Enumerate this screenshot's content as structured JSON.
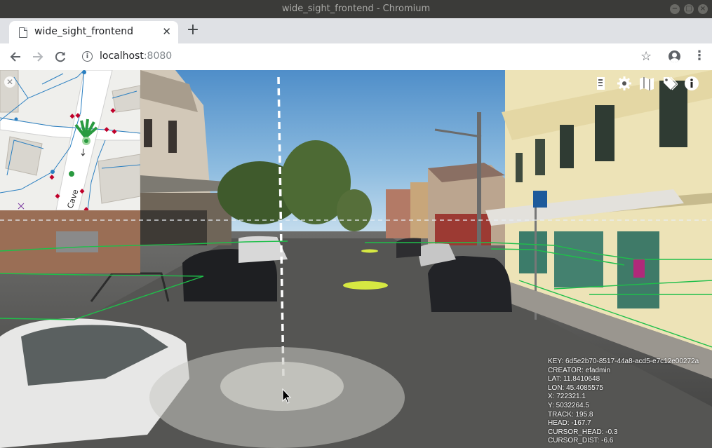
{
  "window": {
    "title": "wide_sight_frontend - Chromium"
  },
  "tab": {
    "title": "wide_sight_frontend",
    "icon": "page-icon"
  },
  "toolbar": {
    "host": "localhost",
    "port": ":8080"
  },
  "map": {
    "street_label": "Cave"
  },
  "tools": [
    "book-icon",
    "gear-icon",
    "map-icon",
    "tag-icon",
    "info-icon"
  ],
  "hud": {
    "key": "KEY: 6d5e2b70-8517-44a8-acd5-e7c12e00272a",
    "creator": "CREATOR: efadmin",
    "lat": "LAT: 11.8410648",
    "lon": "LON: 45.4085575",
    "x": "X: 722321.1",
    "y": "Y: 5032264.5",
    "track": "TRACK: 195.8",
    "head": "HEAD: -167.7",
    "cursor_head": "CURSOR_HEAD: -0.3",
    "cursor_dist": "CURSOR_DIST: -6.6"
  },
  "colors": {
    "overlay_line": "#1fbf4a",
    "map_road_line": "#2a7fc1",
    "map_point": "#c0002a",
    "map_node": "#2a9a40"
  }
}
